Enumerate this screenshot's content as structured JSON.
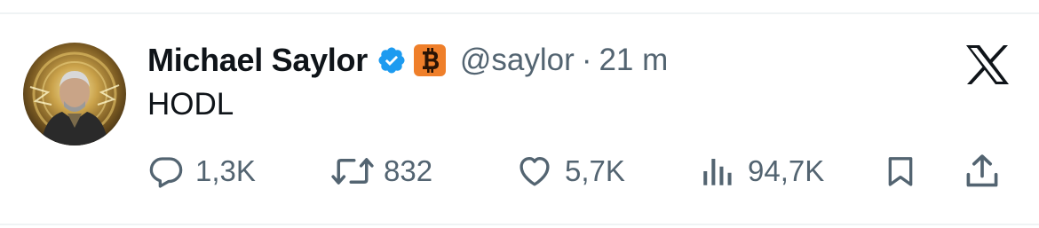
{
  "tweet": {
    "author_name": "Michael Saylor",
    "handle": "@saylor",
    "separator": "·",
    "time": "21 m",
    "text": "HODL"
  },
  "icons": {
    "verified": "verified-badge-icon",
    "affiliate": "bitcoin-badge-icon",
    "platform": "x-logo-icon",
    "reply": "reply-icon",
    "repost": "repost-icon",
    "like": "heart-icon",
    "views": "views-bar-chart-icon",
    "bookmark": "bookmark-icon",
    "share": "share-icon"
  },
  "actions": {
    "replies": "1,3K",
    "reposts": "832",
    "likes": "5,7K",
    "views": "94,7K"
  },
  "colors": {
    "verified_blue": "#1d9bf0",
    "bitcoin_orange": "#ef7f2a",
    "text_primary": "#0f1419",
    "text_secondary": "#536471"
  }
}
